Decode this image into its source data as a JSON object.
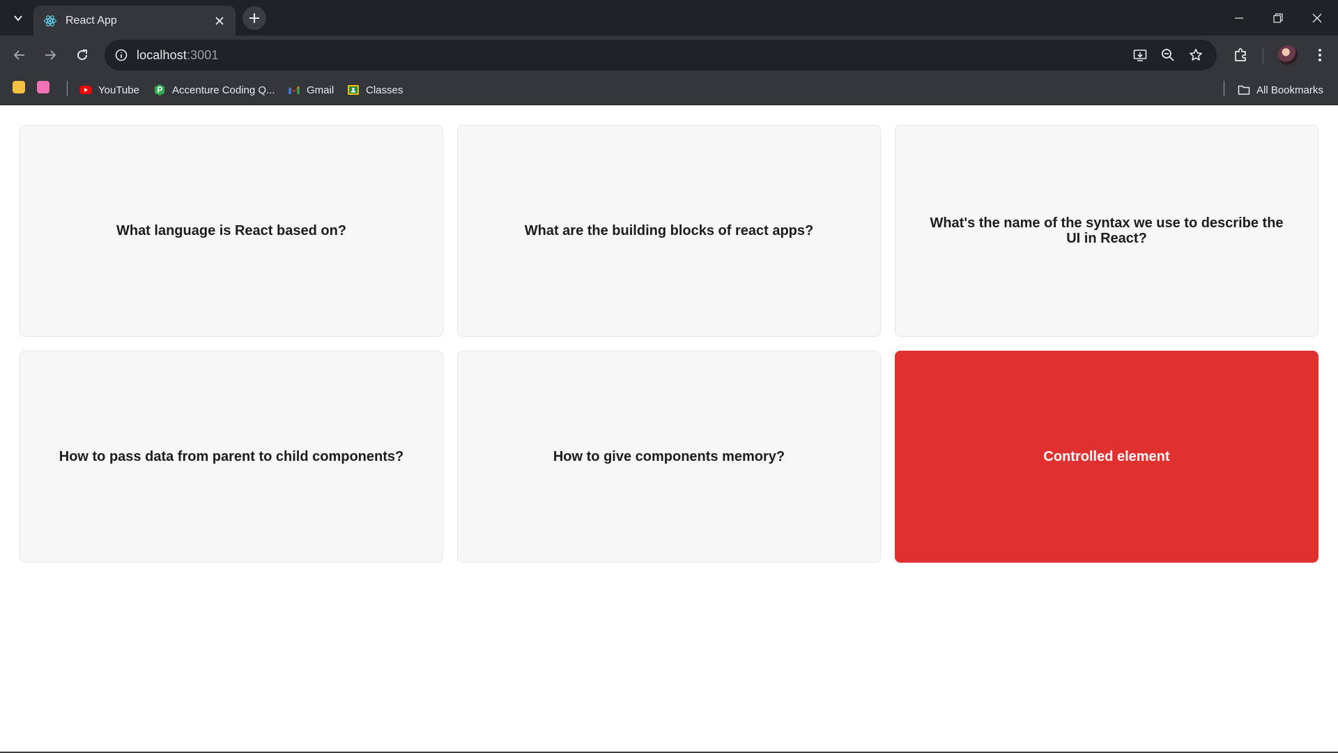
{
  "browser": {
    "tab": {
      "title": "React App",
      "favicon": "react-atom-icon"
    },
    "address": {
      "host": "localhost",
      "port": ":3001"
    },
    "bookmarks": [
      {
        "label": "YouTube",
        "icon": "youtube-icon"
      },
      {
        "label": "Accenture Coding Q...",
        "icon": "accenture-icon"
      },
      {
        "label": "Gmail",
        "icon": "gmail-icon"
      },
      {
        "label": "Classes",
        "icon": "classroom-icon"
      }
    ],
    "all_bookmarks_label": "All Bookmarks"
  },
  "flashcards": [
    {
      "text": "What language is React based on?",
      "selected": false
    },
    {
      "text": "What are the building blocks of react apps?",
      "selected": false
    },
    {
      "text": "What's the name of the syntax we use to describe the UI in React?",
      "selected": false
    },
    {
      "text": "How to pass data from parent to child components?",
      "selected": false
    },
    {
      "text": "How to give components memory?",
      "selected": false
    },
    {
      "text": "Controlled element",
      "selected": true
    }
  ],
  "colors": {
    "selected_card": "#e03131",
    "card": "#f7f7f7",
    "chrome_dark": "#202124",
    "chrome": "#35363a"
  }
}
